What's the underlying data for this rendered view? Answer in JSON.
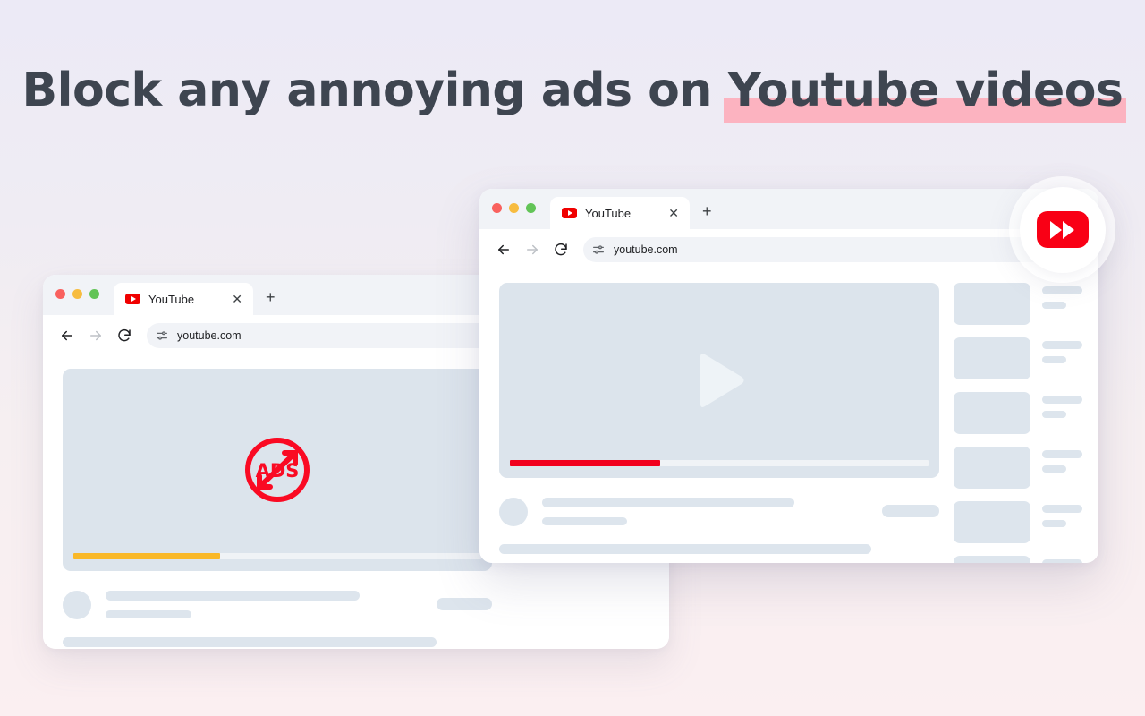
{
  "headline": {
    "lead": "Block any annoying ads on ",
    "highlighted": "Youtube videos",
    "highlight_color": "#fcb3c0",
    "text_color": "#3e4550"
  },
  "background": {
    "gradient_top": "#eceaf6",
    "gradient_bottom": "#fbeff1"
  },
  "logo_badge": {
    "name": "fast-forward-logo",
    "mark_color": "#f90015",
    "glyph": "fast-forward"
  },
  "windows": {
    "back": {
      "traffic_lights": [
        "#f9615e",
        "#f7bc3f",
        "#62c457"
      ],
      "tab": {
        "title": "YouTube",
        "close_glyph": "✕",
        "new_tab_glyph": "+"
      },
      "nav": {
        "back_label": "Back",
        "forward_label": "Forward",
        "reload_label": "Reload",
        "url": "youtube.com",
        "site_settings_icon": "tune-icon"
      },
      "video": {
        "state": "ad-playing",
        "overlay_icon": "no-ads-icon",
        "overlay_text": "ADS",
        "overlay_color": "#fa0a23",
        "progress_percent": 36,
        "progress_color": "#f9b828"
      },
      "sidebar_items": [
        {
          "lines": 2
        },
        {
          "lines": 2
        },
        {
          "lines": 2
        }
      ]
    },
    "front": {
      "traffic_lights": [
        "#f9615e",
        "#f7bc3f",
        "#62c457"
      ],
      "tab": {
        "title": "YouTube",
        "close_glyph": "✕",
        "new_tab_glyph": "+"
      },
      "nav": {
        "back_label": "Back",
        "forward_label": "Forward",
        "reload_label": "Reload",
        "url": "youtube.com",
        "site_settings_icon": "tune-icon"
      },
      "video": {
        "state": "video-playing",
        "overlay_icon": "play-icon",
        "progress_percent": 36,
        "progress_color": "#f1001e"
      },
      "sidebar_items": [
        {
          "lines": 2
        },
        {
          "lines": 2
        },
        {
          "lines": 2
        },
        {
          "lines": 2
        },
        {
          "lines": 2
        },
        {
          "lines": 2
        }
      ]
    }
  }
}
